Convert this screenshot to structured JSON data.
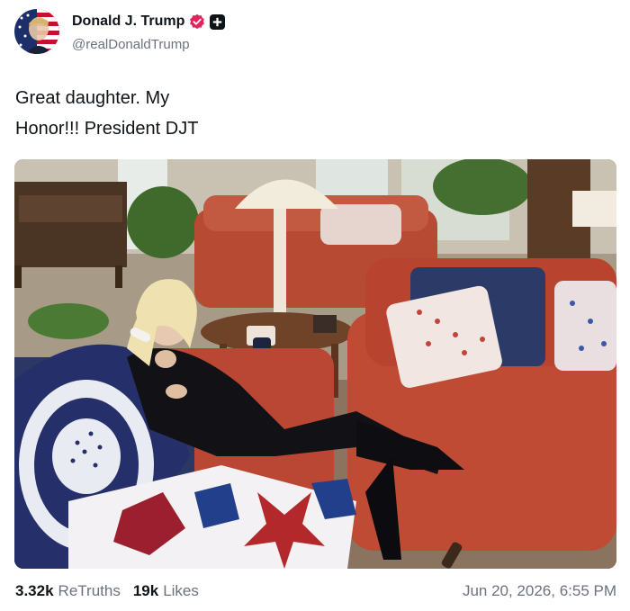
{
  "author": {
    "display_name": "Donald J. Trump",
    "handle": "@realDonaldTrump",
    "avatar_icon": "avatar-flag-portrait",
    "verified_icon": "verified-badge-icon",
    "verified_color": "#e0245e",
    "plus_icon": "plus-badge-icon"
  },
  "post": {
    "text_lines": [
      "Great daughter. My",
      "Honor!!! President DJT"
    ],
    "media_description_icon": "photo-image"
  },
  "stats": {
    "retruths_count": "3.32k",
    "retruths_label": "ReTruths",
    "likes_count": "19k",
    "likes_label": "Likes"
  },
  "timestamp": "Jun 20, 2026, 6:55 PM",
  "colors": {
    "text_primary": "#0f1419",
    "text_secondary": "#6b7280",
    "background": "#ffffff"
  }
}
